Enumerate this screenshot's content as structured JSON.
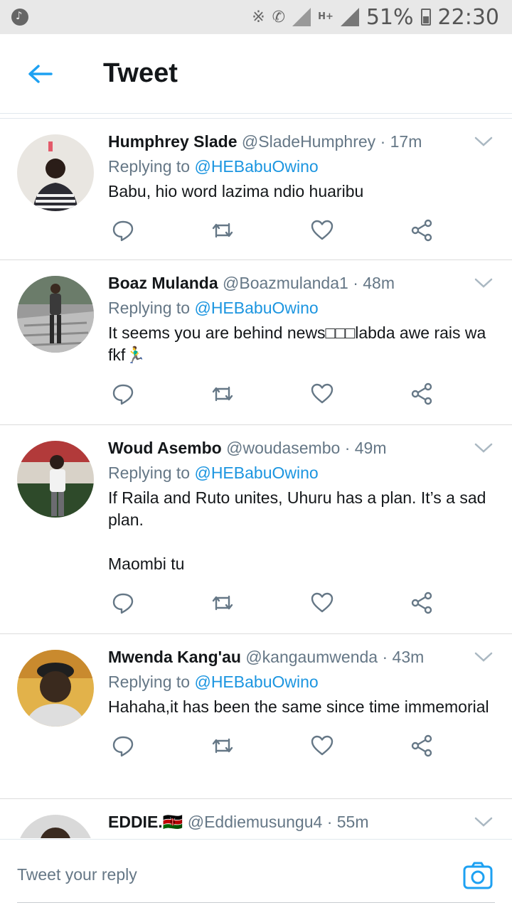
{
  "status_bar": {
    "battery": "51%",
    "time": "22:30",
    "network": "H+"
  },
  "header": {
    "title": "Tweet"
  },
  "tweets": [
    {
      "name": "Humphrey Slade",
      "handle": "@SladeHumphrey",
      "time": "17m",
      "replying_label": "Replying to",
      "replying_to": "@HEBabuOwino",
      "text": "Babu, hio word lazima ndio huaribu",
      "avatar_colors": [
        "#e9e6e1",
        "#2b2b33",
        "#f1f1f1"
      ]
    },
    {
      "name": "Boaz Mulanda",
      "handle": "@Boazmulanda1",
      "time": "48m",
      "replying_label": "Replying to",
      "replying_to": "@HEBabuOwino",
      "text": "It seems you are behind news□□□labda awe rais wa fkf🏃‍♂️",
      "avatar_colors": [
        "#9a9a9a",
        "#3a3a3a",
        "#6b7c6a"
      ]
    },
    {
      "name": "Woud Asembo",
      "handle": "@woudasembo",
      "time": "49m",
      "replying_label": "Replying to",
      "replying_to": "@HEBabuOwino",
      "text": "If Raila and Ruto unites, Uhuru has a plan. It’s a sad plan.\n\nMaombi tu",
      "avatar_colors": [
        "#b23a3a",
        "#2e4a2a",
        "#d8d2c8"
      ]
    },
    {
      "name": "Mwenda Kang'au",
      "handle": "@kangaumwenda",
      "time": "43m",
      "replying_label": "Replying to",
      "replying_to": "@HEBabuOwino",
      "text": "Hahaha,it has been the same since time immemorial",
      "avatar_colors": [
        "#e2b24a",
        "#3a2a1e",
        "#dedede"
      ]
    },
    {
      "name": "EDDIE.🇰🇪",
      "handle": "@Eddiemusungu4",
      "time": "55m",
      "replying_label": "",
      "replying_to": "",
      "text": "",
      "avatar_colors": [
        "#d9d9d9",
        "#3a2a20",
        "#ffffff"
      ]
    }
  ],
  "reply_bar": {
    "placeholder": "Tweet your reply"
  },
  "colors": {
    "accent": "#1da1f2",
    "muted": "#657786",
    "text": "#14171a"
  }
}
